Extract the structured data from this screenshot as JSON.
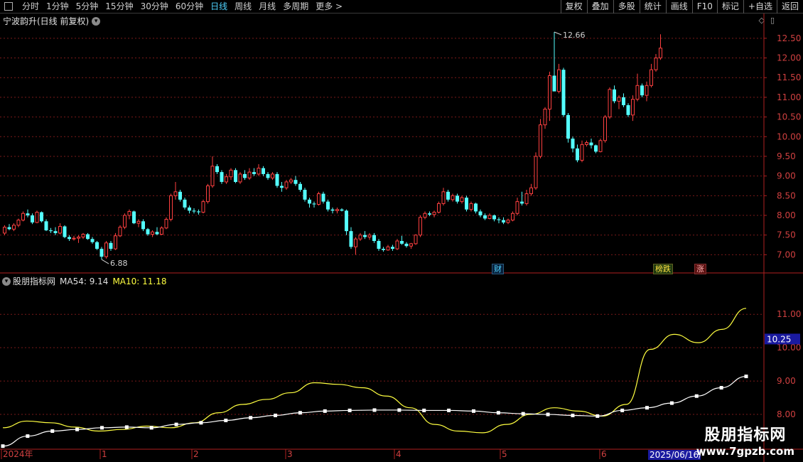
{
  "toolbar": {
    "periods": [
      "分时",
      "1分钟",
      "5分钟",
      "15分钟",
      "30分钟",
      "60分钟",
      "日线",
      "周线",
      "月线",
      "多周期",
      "更多 >"
    ],
    "active_period": "日线",
    "buttons": [
      "复权",
      "叠加",
      "多股",
      "统计",
      "画线",
      "F10",
      "标记",
      "+自选",
      "返回"
    ]
  },
  "main_title": "宁波韵升(日线 前复权)",
  "indicator": {
    "name": "股朋指标网",
    "ma54_label": "MA54: 9.14",
    "ma10_label": "MA10: 11.18"
  },
  "annotations": {
    "high": "12.66",
    "low": "6.88",
    "tag_cai": "财",
    "tag_bang": "榜跌",
    "tag_zhang": "涨"
  },
  "price_axis": [
    "12.50",
    "12.00",
    "11.50",
    "11.00",
    "10.50",
    "10.00",
    "9.50",
    "9.00",
    "8.50",
    "8.00",
    "7.50",
    "7.00"
  ],
  "ind_axis": [
    "11.00",
    "10.00",
    "9.00",
    "8.00"
  ],
  "ind_current": "10.25",
  "date_labels": [
    "2024年",
    "1",
    "2",
    "3",
    "4",
    "5",
    "6"
  ],
  "date_current": "2025/06/16/-",
  "watermark": {
    "line1": "股朋指标网",
    "line2": "www.7gpzb.com"
  },
  "colors": {
    "up": "#ff4040",
    "down": "#54ffff",
    "ma10": "#ffff40",
    "ma54": "#ffffff",
    "grid": "#7a1a1a"
  },
  "chart_data": [
    {
      "type": "candlestick",
      "title": "宁波韵升(日线 前复权)",
      "ylim": [
        6.7,
        12.75
      ],
      "ohlc": [
        [
          7.55,
          7.75,
          7.5,
          7.7
        ],
        [
          7.7,
          7.78,
          7.62,
          7.65
        ],
        [
          7.65,
          7.8,
          7.6,
          7.75
        ],
        [
          7.75,
          7.92,
          7.7,
          7.88
        ],
        [
          7.88,
          8.1,
          7.85,
          8.05
        ],
        [
          8.05,
          8.15,
          7.95,
          8.0
        ],
        [
          8.0,
          8.05,
          7.78,
          7.82
        ],
        [
          7.82,
          8.12,
          7.8,
          8.08
        ],
        [
          8.08,
          8.1,
          7.82,
          7.85
        ],
        [
          7.85,
          7.9,
          7.6,
          7.62
        ],
        [
          7.62,
          7.68,
          7.55,
          7.6
        ],
        [
          7.6,
          7.7,
          7.5,
          7.55
        ],
        [
          7.55,
          7.8,
          7.52,
          7.72
        ],
        [
          7.72,
          7.75,
          7.42,
          7.45
        ],
        [
          7.45,
          7.5,
          7.35,
          7.4
        ],
        [
          7.4,
          7.48,
          7.36,
          7.42
        ],
        [
          7.42,
          7.5,
          7.3,
          7.45
        ],
        [
          7.45,
          7.55,
          7.4,
          7.52
        ],
        [
          7.52,
          7.55,
          7.38,
          7.4
        ],
        [
          7.4,
          7.45,
          7.28,
          7.32
        ],
        [
          7.32,
          7.35,
          7.12,
          7.15
        ],
        [
          7.15,
          7.2,
          6.88,
          6.95
        ],
        [
          6.95,
          7.35,
          6.9,
          7.3
        ],
        [
          7.3,
          7.35,
          7.1,
          7.15
        ],
        [
          7.15,
          7.55,
          7.12,
          7.48
        ],
        [
          7.48,
          7.75,
          7.45,
          7.7
        ],
        [
          7.7,
          8.05,
          7.65,
          8.0
        ],
        [
          8.0,
          8.15,
          7.9,
          8.1
        ],
        [
          8.1,
          8.12,
          7.78,
          7.8
        ],
        [
          7.8,
          7.9,
          7.7,
          7.85
        ],
        [
          7.85,
          7.9,
          7.6,
          7.65
        ],
        [
          7.65,
          7.68,
          7.48,
          7.52
        ],
        [
          7.52,
          7.62,
          7.45,
          7.58
        ],
        [
          7.58,
          7.7,
          7.5,
          7.52
        ],
        [
          7.52,
          7.72,
          7.5,
          7.68
        ],
        [
          7.68,
          7.95,
          7.65,
          7.9
        ],
        [
          7.9,
          8.55,
          7.85,
          8.5
        ],
        [
          8.5,
          8.85,
          8.4,
          8.6
        ],
        [
          8.6,
          8.65,
          8.35,
          8.4
        ],
        [
          8.4,
          8.45,
          8.15,
          8.2
        ],
        [
          8.2,
          8.25,
          8.05,
          8.12
        ],
        [
          8.12,
          8.18,
          8.05,
          8.1
        ],
        [
          8.1,
          8.15,
          8.02,
          8.08
        ],
        [
          8.08,
          8.4,
          8.05,
          8.35
        ],
        [
          8.35,
          8.8,
          8.3,
          8.75
        ],
        [
          8.75,
          9.5,
          8.7,
          9.25
        ],
        [
          9.25,
          9.3,
          9.05,
          9.1
        ],
        [
          9.1,
          9.15,
          8.8,
          8.85
        ],
        [
          8.85,
          9.05,
          8.8,
          8.98
        ],
        [
          8.98,
          9.2,
          8.9,
          9.15
        ],
        [
          9.15,
          9.2,
          8.82,
          8.85
        ],
        [
          8.85,
          9.1,
          8.8,
          9.05
        ],
        [
          9.05,
          9.15,
          8.9,
          8.95
        ],
        [
          8.95,
          9.2,
          8.9,
          9.1
        ],
        [
          9.1,
          9.2,
          9.0,
          9.05
        ],
        [
          9.05,
          9.3,
          9.0,
          9.2
        ],
        [
          9.2,
          9.25,
          9.0,
          9.05
        ],
        [
          9.05,
          9.1,
          8.9,
          8.95
        ],
        [
          8.95,
          9.1,
          8.9,
          9.05
        ],
        [
          9.05,
          9.1,
          8.7,
          8.75
        ],
        [
          8.75,
          8.85,
          8.6,
          8.7
        ],
        [
          8.7,
          8.9,
          8.65,
          8.85
        ],
        [
          8.85,
          8.95,
          8.8,
          8.9
        ],
        [
          8.9,
          9.0,
          8.75,
          8.8
        ],
        [
          8.8,
          8.85,
          8.6,
          8.65
        ],
        [
          8.65,
          8.7,
          8.35,
          8.4
        ],
        [
          8.4,
          8.45,
          8.2,
          8.3
        ],
        [
          8.3,
          8.35,
          8.2,
          8.28
        ],
        [
          8.28,
          8.6,
          8.25,
          8.55
        ],
        [
          8.55,
          8.6,
          8.3,
          8.35
        ],
        [
          8.35,
          8.4,
          8.1,
          8.15
        ],
        [
          8.15,
          8.2,
          8.05,
          8.12
        ],
        [
          8.12,
          8.2,
          8.05,
          8.15
        ],
        [
          8.15,
          8.18,
          8.1,
          8.12
        ],
        [
          8.12,
          8.15,
          7.5,
          7.6
        ],
        [
          7.6,
          7.7,
          7.15,
          7.2
        ],
        [
          7.2,
          7.45,
          7.0,
          7.4
        ],
        [
          7.4,
          7.55,
          7.35,
          7.5
        ],
        [
          7.5,
          7.6,
          7.4,
          7.45
        ],
        [
          7.45,
          7.55,
          7.38,
          7.5
        ],
        [
          7.5,
          7.55,
          7.3,
          7.35
        ],
        [
          7.35,
          7.4,
          7.1,
          7.15
        ],
        [
          7.15,
          7.2,
          7.08,
          7.12
        ],
        [
          7.12,
          7.25,
          7.1,
          7.2
        ],
        [
          7.2,
          7.25,
          7.1,
          7.15
        ],
        [
          7.15,
          7.4,
          7.12,
          7.35
        ],
        [
          7.35,
          7.48,
          7.25,
          7.28
        ],
        [
          7.28,
          7.32,
          7.18,
          7.22
        ],
        [
          7.22,
          7.3,
          7.15,
          7.28
        ],
        [
          7.28,
          7.52,
          7.25,
          7.5
        ],
        [
          7.5,
          8.0,
          7.45,
          7.95
        ],
        [
          7.95,
          8.1,
          7.9,
          8.05
        ],
        [
          8.05,
          8.1,
          7.98,
          8.02
        ],
        [
          8.02,
          8.12,
          7.95,
          8.08
        ],
        [
          8.08,
          8.35,
          8.05,
          8.3
        ],
        [
          8.3,
          8.7,
          8.25,
          8.6
        ],
        [
          8.6,
          8.65,
          8.35,
          8.4
        ],
        [
          8.4,
          8.55,
          8.35,
          8.5
        ],
        [
          8.5,
          8.55,
          8.3,
          8.35
        ],
        [
          8.35,
          8.5,
          8.3,
          8.45
        ],
        [
          8.45,
          8.5,
          8.1,
          8.15
        ],
        [
          8.15,
          8.35,
          8.1,
          8.3
        ],
        [
          8.3,
          8.32,
          8.05,
          8.1
        ],
        [
          8.1,
          8.15,
          7.95,
          8.0
        ],
        [
          8.0,
          8.05,
          7.88,
          7.92
        ],
        [
          7.92,
          8.05,
          7.9,
          8.0
        ],
        [
          8.0,
          8.02,
          7.85,
          7.9
        ],
        [
          7.9,
          7.95,
          7.8,
          7.88
        ],
        [
          7.88,
          7.95,
          7.78,
          7.82
        ],
        [
          7.82,
          7.92,
          7.78,
          7.88
        ],
        [
          7.88,
          8.1,
          7.85,
          8.05
        ],
        [
          8.05,
          8.45,
          8.0,
          8.35
        ],
        [
          8.35,
          8.6,
          8.25,
          8.3
        ],
        [
          8.3,
          8.65,
          8.25,
          8.55
        ],
        [
          8.55,
          8.8,
          8.5,
          8.7
        ],
        [
          8.7,
          9.6,
          8.65,
          9.5
        ],
        [
          9.5,
          10.45,
          9.45,
          10.3
        ],
        [
          10.3,
          10.75,
          10.2,
          10.7
        ],
        [
          10.7,
          11.65,
          10.4,
          11.55
        ],
        [
          11.55,
          12.66,
          11.2,
          11.15
        ],
        [
          11.15,
          11.85,
          11.1,
          11.7
        ],
        [
          11.7,
          11.75,
          10.5,
          10.55
        ],
        [
          10.55,
          10.6,
          9.85,
          9.95
        ],
        [
          9.95,
          10.0,
          9.6,
          9.7
        ],
        [
          9.7,
          9.8,
          9.35,
          9.4
        ],
        [
          9.4,
          9.9,
          9.35,
          9.8
        ],
        [
          9.8,
          9.9,
          9.75,
          9.85
        ],
        [
          9.85,
          9.95,
          9.7,
          9.78
        ],
        [
          9.78,
          9.8,
          9.58,
          9.62
        ],
        [
          9.62,
          9.95,
          9.6,
          9.9
        ],
        [
          9.9,
          10.55,
          9.85,
          10.5
        ],
        [
          10.5,
          11.25,
          10.45,
          11.2
        ],
        [
          11.2,
          11.3,
          10.85,
          10.9
        ],
        [
          10.9,
          11.05,
          10.7,
          11.0
        ],
        [
          11.0,
          11.1,
          10.75,
          10.8
        ],
        [
          10.8,
          10.85,
          10.5,
          10.55
        ],
        [
          10.55,
          11.05,
          10.4,
          10.95
        ],
        [
          10.95,
          11.6,
          10.9,
          11.3
        ],
        [
          11.3,
          11.35,
          11.0,
          11.05
        ],
        [
          11.05,
          11.4,
          10.9,
          11.3
        ],
        [
          11.3,
          11.85,
          11.25,
          11.7
        ],
        [
          11.7,
          12.1,
          11.65,
          12.0
        ],
        [
          12.0,
          12.6,
          11.95,
          12.25
        ]
      ]
    },
    {
      "type": "line",
      "title": "股朋指标网",
      "ylim": [
        7.0,
        11.9
      ],
      "series": [
        {
          "name": "MA54",
          "values": [
            7.05,
            7.35,
            7.5,
            7.55,
            7.6,
            7.62,
            7.6,
            7.7,
            7.75,
            7.82,
            7.9,
            7.97,
            8.05,
            8.1,
            8.12,
            8.13,
            8.13,
            8.12,
            8.12,
            8.1,
            8.05,
            8.02,
            8.0,
            7.97,
            7.95,
            8.12,
            8.2,
            8.34,
            8.55,
            8.8,
            9.14
          ]
        },
        {
          "name": "MA10",
          "values": [
            7.6,
            7.8,
            7.75,
            7.62,
            7.5,
            7.55,
            7.65,
            7.6,
            7.75,
            8.05,
            8.3,
            8.45,
            8.65,
            8.95,
            8.9,
            8.8,
            8.55,
            8.2,
            7.7,
            7.5,
            7.45,
            7.7,
            8.0,
            8.2,
            8.1,
            7.95,
            8.3,
            9.95,
            10.4,
            10.15,
            10.55,
            11.18
          ]
        }
      ]
    }
  ]
}
